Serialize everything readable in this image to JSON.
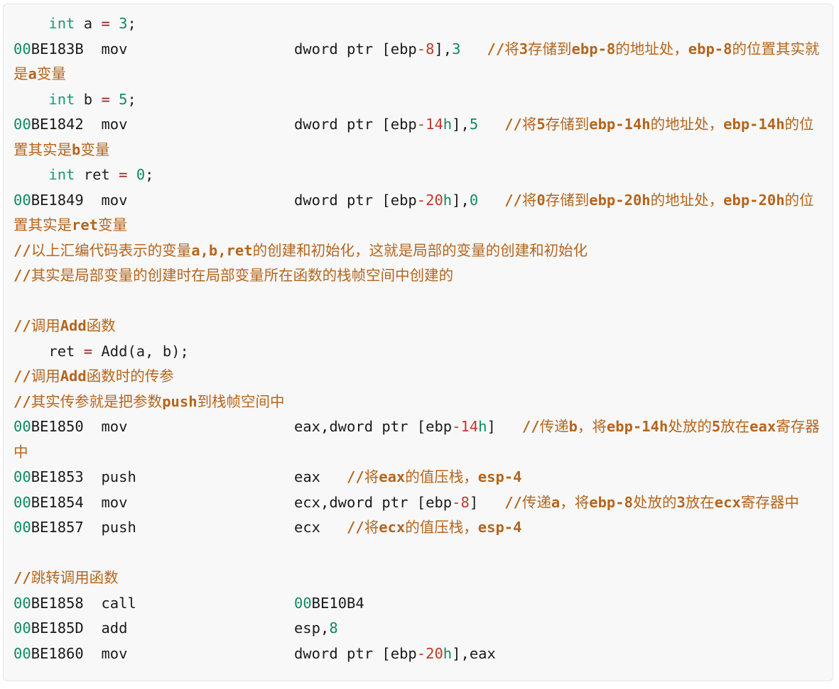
{
  "block": {
    "language": "x86-assembly-annotated",
    "background": "#f8f8f8",
    "border_color": "#e3e6e8"
  },
  "colors": {
    "keyword": "#1a9a78",
    "number": "#0e8a5f",
    "operator": "#a02020",
    "plain": "#1a1a1a",
    "negative_offset": "#c0392b",
    "comment": "#b5651d"
  },
  "lines": [
    {
      "id": "l1",
      "kind": "source",
      "text": "    int a = 3;"
    },
    {
      "id": "l2",
      "kind": "asm",
      "address": "00BE183B",
      "mnemonic": "mov",
      "operands": "dword ptr [ebp-8],3",
      "comment": "//将3存储到ebp-8的地址处，ebp-8的位置其实就是a变量"
    },
    {
      "id": "l3",
      "kind": "source",
      "text": "    int b = 5;"
    },
    {
      "id": "l4",
      "kind": "asm",
      "address": "00BE1842",
      "mnemonic": "mov",
      "operands": "dword ptr [ebp-14h],5",
      "comment": "//将5存储到ebp-14h的地址处，ebp-14h的位置其实是b变量"
    },
    {
      "id": "l5",
      "kind": "source",
      "text": "    int ret = 0;"
    },
    {
      "id": "l6",
      "kind": "asm",
      "address": "00BE1849",
      "mnemonic": "mov",
      "operands": "dword ptr [ebp-20h],0",
      "comment": "//将0存储到ebp-20h的地址处，ebp-20h的位置其实是ret变量"
    },
    {
      "id": "l7",
      "kind": "comment",
      "text": "//以上汇编代码表示的变量a,b,ret的创建和初始化，这就是局部的变量的创建和初始化"
    },
    {
      "id": "l8",
      "kind": "comment",
      "text": "//其实是局部变量的创建时在局部变量所在函数的栈帧空间中创建的"
    },
    {
      "id": "l9",
      "kind": "blank",
      "text": ""
    },
    {
      "id": "l10",
      "kind": "comment",
      "text": "//调用Add函数"
    },
    {
      "id": "l11",
      "kind": "source",
      "text": "    ret = Add(a, b);"
    },
    {
      "id": "l12",
      "kind": "comment",
      "text": "//调用Add函数时的传参"
    },
    {
      "id": "l13",
      "kind": "comment",
      "text": "//其实传参就是把参数push到栈帧空间中"
    },
    {
      "id": "l14",
      "kind": "asm",
      "address": "00BE1850",
      "mnemonic": "mov",
      "operands": "eax,dword ptr [ebp-14h]",
      "comment": "//传递b，将ebp-14h处放的5放在eax寄存器中"
    },
    {
      "id": "l15",
      "kind": "asm",
      "address": "00BE1853",
      "mnemonic": "push",
      "operands": "eax",
      "comment": "//将eax的值压栈，esp-4"
    },
    {
      "id": "l16",
      "kind": "asm",
      "address": "00BE1854",
      "mnemonic": "mov",
      "operands": "ecx,dword ptr [ebp-8]",
      "comment": "//传递a，将ebp-8处放的3放在ecx寄存器中"
    },
    {
      "id": "l17",
      "kind": "asm",
      "address": "00BE1857",
      "mnemonic": "push",
      "operands": "ecx",
      "comment": "//将ecx的值压栈，esp-4"
    },
    {
      "id": "l18",
      "kind": "blank",
      "text": ""
    },
    {
      "id": "l19",
      "kind": "comment",
      "text": "//跳转调用函数"
    },
    {
      "id": "l20",
      "kind": "asm",
      "address": "00BE1858",
      "mnemonic": "call",
      "operands": "00BE10B4",
      "comment": ""
    },
    {
      "id": "l21",
      "kind": "asm",
      "address": "00BE185D",
      "mnemonic": "add",
      "operands": "esp,8",
      "comment": ""
    },
    {
      "id": "l22",
      "kind": "asm",
      "address": "00BE1860",
      "mnemonic": "mov",
      "operands": "dword ptr [ebp-20h],eax",
      "comment": ""
    }
  ]
}
